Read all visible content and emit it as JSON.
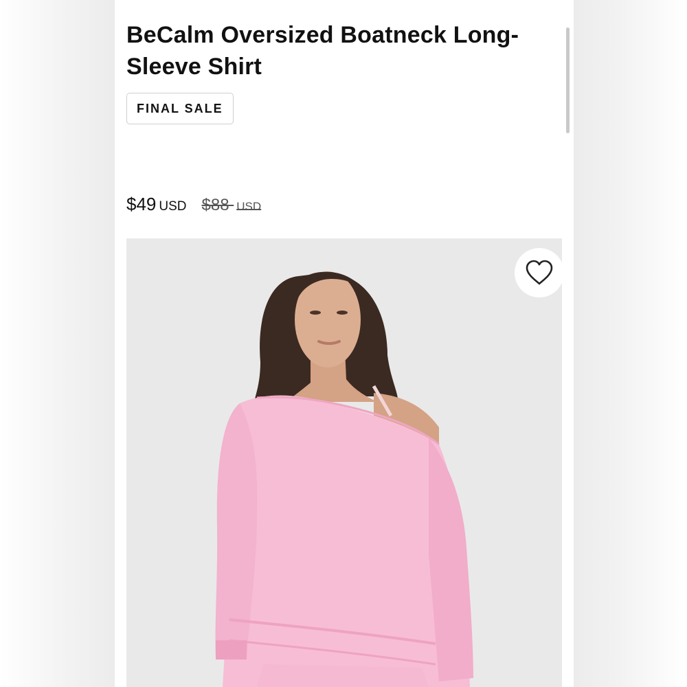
{
  "product": {
    "title": "BeCalm Oversized Boatneck Long-Sleeve Shirt",
    "badge": "FINAL SALE"
  },
  "pricing": {
    "sale_price": "$49",
    "sale_currency": "USD",
    "original_price": "$88",
    "original_currency": "USD"
  },
  "image": {
    "alt": "",
    "favorite_icon": "heart-outline-icon"
  },
  "colors": {
    "shirt": "#f7bdd5",
    "background": "#e9e9e9",
    "hair": "#3b2a22",
    "skin": "#d8a889"
  }
}
